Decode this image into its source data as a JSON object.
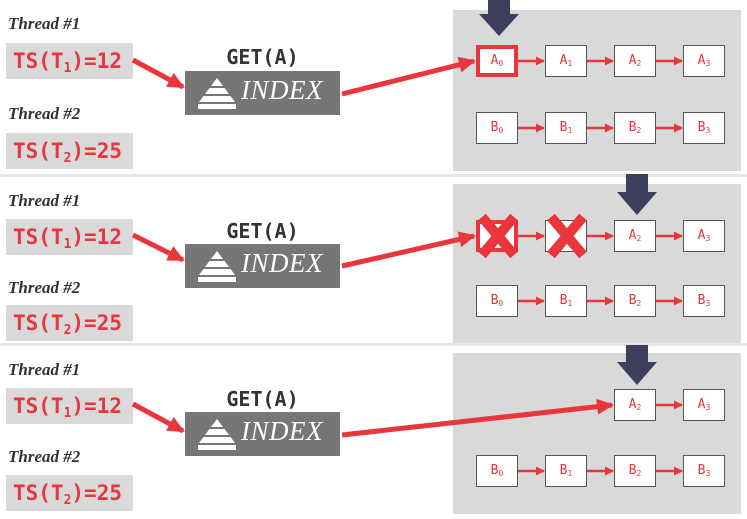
{
  "thread1_label": "Thread #1",
  "thread2_label": "Thread #2",
  "ts1": {
    "prefix": "TS(T",
    "sub": "1",
    "suffix": ")=12"
  },
  "ts2": {
    "prefix": "TS(T",
    "sub": "2",
    "suffix": ")=25"
  },
  "get_label": "GET(A)",
  "index_label": "INDEX",
  "nodes": {
    "a0": {
      "base": "A",
      "sub": "0"
    },
    "a1": {
      "base": "A",
      "sub": "1"
    },
    "a2": {
      "base": "A",
      "sub": "2"
    },
    "a3": {
      "base": "A",
      "sub": "3"
    },
    "b0": {
      "base": "B",
      "sub": "0"
    },
    "b1": {
      "base": "B",
      "sub": "1"
    },
    "b2": {
      "base": "B",
      "sub": "2"
    },
    "b3": {
      "base": "B",
      "sub": "3"
    }
  },
  "colors": {
    "accent": "#e8363c",
    "index_bg": "#767676",
    "panel_bg": "#d9d9d9",
    "pointer": "#3e3f5c"
  }
}
